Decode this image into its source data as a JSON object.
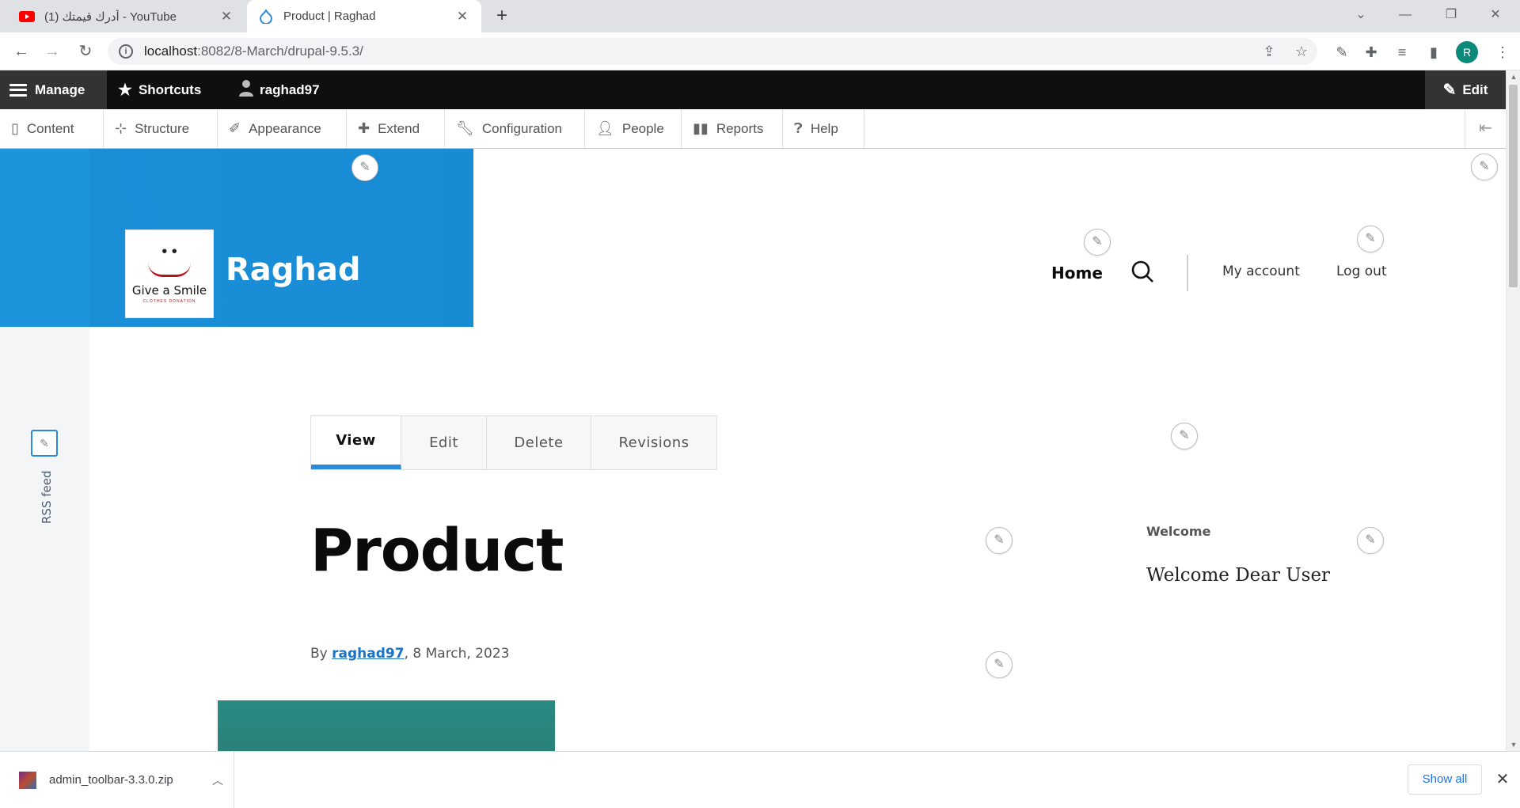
{
  "browser": {
    "tabs": [
      {
        "title": "(1) أدرك قيمتك - YouTube",
        "icon": "youtube-icon",
        "active": false
      },
      {
        "title": "Product | Raghad",
        "icon": "drupal-icon",
        "active": true
      }
    ],
    "url_host": "localhost",
    "url_path": ":8082/8-March/drupal-9.5.3/",
    "profile_initial": "R"
  },
  "admin_toolbar": {
    "manage": "Manage",
    "shortcuts": "Shortcuts",
    "user": "raghad97",
    "edit": "Edit",
    "tray": [
      "Content",
      "Structure",
      "Appearance",
      "Extend",
      "Configuration",
      "People",
      "Reports",
      "Help"
    ]
  },
  "site": {
    "name": "Raghad",
    "logo_text": "Give a Smile",
    "logo_subtext": "CLOTHES DONATION",
    "brand_color": "#1a8fd8"
  },
  "main_nav": {
    "home": "Home",
    "my_account": "My account",
    "log_out": "Log out"
  },
  "sidebar": {
    "rss": "RSS feed"
  },
  "local_tasks": [
    "View",
    "Edit",
    "Delete",
    "Revisions"
  ],
  "node": {
    "title": "Product",
    "by": "By ",
    "author": "raghad97",
    "date": ", 8 March, 2023"
  },
  "block": {
    "heading": "Welcome",
    "body": "Welcome  Dear User"
  },
  "download": {
    "file": "admin_toolbar-3.3.0.zip",
    "show_all": "Show all"
  }
}
